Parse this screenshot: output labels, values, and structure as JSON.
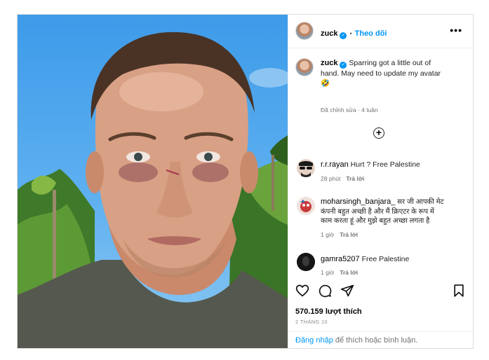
{
  "post": {
    "username": "zuck",
    "follow_label": "Theo dõi",
    "more_icon": "•••",
    "caption_text": "Sparring got a little out of hand. May need to update my avatar 🤣",
    "caption_line1": "Sparring got a little out of",
    "caption_line2": "hand. May need to update my avatar",
    "caption_emoji": "🤣",
    "caption_meta": "Đã chỉnh sửa · 4 tuần",
    "load_more_icon": "plus-circle-icon",
    "comments": [
      {
        "username": "r.r.rayan",
        "text": "Hurt ? Free Palestine",
        "time": "28 phút",
        "reply": "Trả lời"
      },
      {
        "username": "moharsingh_banjara_",
        "text": "सर जी आपकी मेट कंपनी बहुत अच्छी है और मैं क्रिएटर के रूप में काम करता हूं और मुझे बहुत अच्छा लगता है",
        "line1": "सर जी आपकी मेट",
        "line2": "कंपनी बहुत अच्छी है और मैं क्रिएटर के रूप में",
        "line3": "काम करता हूं और मुझे बहुत अच्छा लगता है",
        "time": "1 giờ",
        "reply": "Trả lời"
      },
      {
        "username": "gamra5207",
        "text": "Free Palestine",
        "time": "1 giờ",
        "reply": "Trả lời"
      }
    ],
    "likes": "570.159 lượt thích",
    "date": "2 THÁNG 10",
    "footer_login": "Đăng nhập",
    "footer_rest": " để thích hoặc bình luận."
  },
  "colors": {
    "accent": "#0095f6",
    "border": "#dbdbdb",
    "muted": "#737373"
  }
}
